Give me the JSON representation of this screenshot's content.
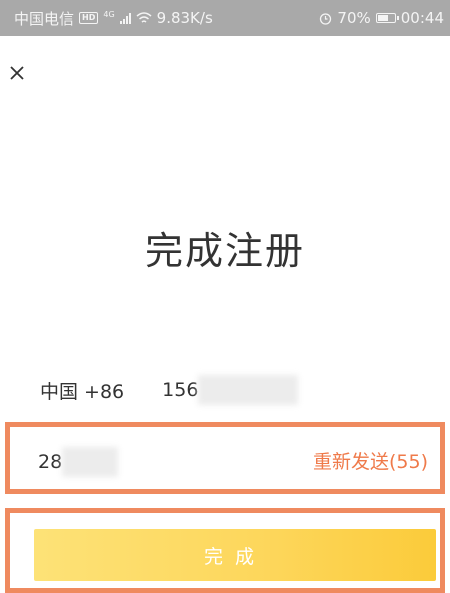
{
  "status_bar": {
    "carrier": "中国电信",
    "hd": "HD",
    "network": "4G",
    "speed": "9.83K/s",
    "alarm_icon": "alarm-icon",
    "battery_text": "70%",
    "battery_level": 0.7,
    "time": "00:44"
  },
  "header": {
    "close_icon": "close-icon",
    "close_glyph": "×"
  },
  "title": "完成注册",
  "phone": {
    "country": "中国 +86",
    "number_prefix": "156"
  },
  "code": {
    "value_prefix": "28",
    "resend_label": "重新发送(55)"
  },
  "submit": {
    "label": "完成"
  },
  "colors": {
    "accent": "#ef7a4a",
    "highlight_border": "#ef8a5f",
    "button_start": "#fde277",
    "button_end": "#fbcb3a",
    "status_bar": "#a9a9a9"
  }
}
